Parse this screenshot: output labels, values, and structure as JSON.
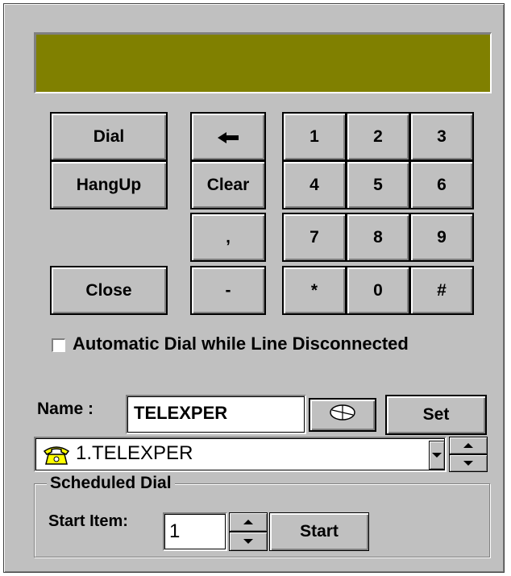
{
  "keypad": {
    "dial": "Dial",
    "hangup": "HangUp",
    "close": "Close",
    "backspace": "←",
    "clear": "Clear",
    "comma": ",",
    "dash": "-",
    "keys": [
      "1",
      "2",
      "3",
      "4",
      "5",
      "6",
      "7",
      "8",
      "9",
      "*",
      "0",
      "#"
    ]
  },
  "auto_dial": {
    "label": "Automatic Dial while Line Disconnected",
    "checked": false
  },
  "name": {
    "label": "Name :",
    "value": "TELEXPER",
    "set_label": "Set"
  },
  "phonebook": {
    "selected": "1.TELEXPER"
  },
  "scheduled": {
    "title": "Scheduled Dial",
    "start_item_label": "Start Item:",
    "start_item_value": "1",
    "start_label": "Start"
  },
  "colors": {
    "display": "#808000",
    "face": "#c0c0c0",
    "phone_icon": "#ffff00"
  }
}
